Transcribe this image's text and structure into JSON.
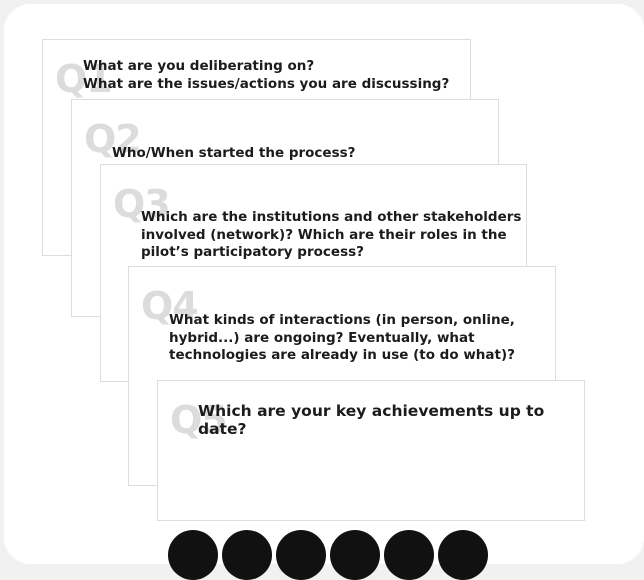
{
  "cards": [
    {
      "num": "Q1",
      "text": "What are you deliberating on?\nWhat are the issues/actions you are discussing?"
    },
    {
      "num": "Q2",
      "text": "Who/When started the process?"
    },
    {
      "num": "Q3",
      "text": "Which are the institutions and other stakeholders\ninvolved (network)? Which are their roles in the\npilot’s participatory process?"
    },
    {
      "num": "Q4",
      "text": "What kinds of interactions (in person, online,\nhybrid...) are ongoing? Eventually, what\ntechnologies are already in use (to do what)?"
    },
    {
      "num": "Q5",
      "text": "Which are your key achievements up to date?"
    }
  ],
  "pager": {
    "count": 6
  },
  "colors": {
    "background": "#f1f1f1",
    "card": "#ffffff",
    "card_border": "#dddddd",
    "text": "#1c1c1c",
    "watermark": "#dcdcdc",
    "dot": "#111111"
  }
}
